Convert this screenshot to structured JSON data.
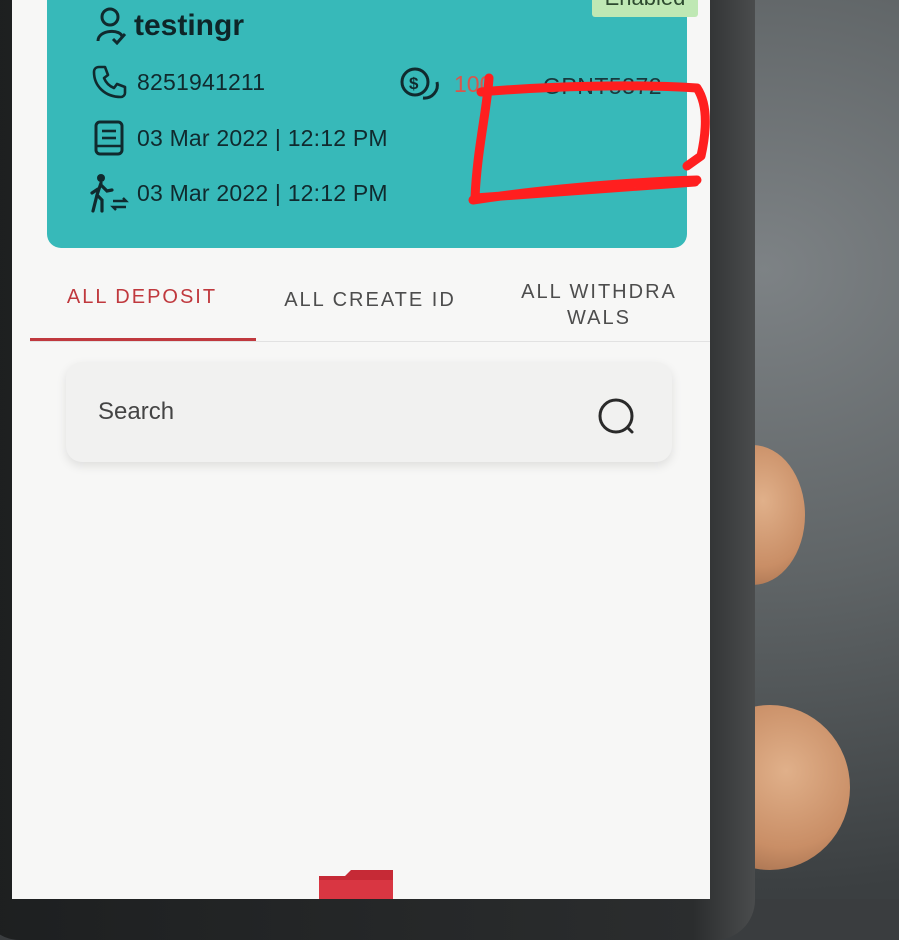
{
  "profile": {
    "username": "testingr",
    "status": "Enabled",
    "phone": "8251941211",
    "coins": "100",
    "code": "GPNT5372",
    "created_date": "03 Mar 2022 | 12:12 PM",
    "activity_date": "03 Mar 2022 | 12:12 PM",
    "icons": [
      "user-check-icon",
      "phone-icon",
      "coin-icon",
      "document-icon",
      "walking-transfer-icon"
    ]
  },
  "tabs": [
    {
      "label": "ALL DEPOSIT",
      "active": true
    },
    {
      "label": "ALL CREATE ID",
      "active": false
    },
    {
      "label_line1": "ALL WITHDRA",
      "label_line2": "WALS",
      "active": false
    }
  ],
  "search": {
    "placeholder": "Search",
    "value": ""
  },
  "colors": {
    "card": "#37b9b9",
    "accent": "#c0393e",
    "badge": "#bfe8b4",
    "coins": "#d9564c",
    "redaction": "#ff1f1f"
  }
}
